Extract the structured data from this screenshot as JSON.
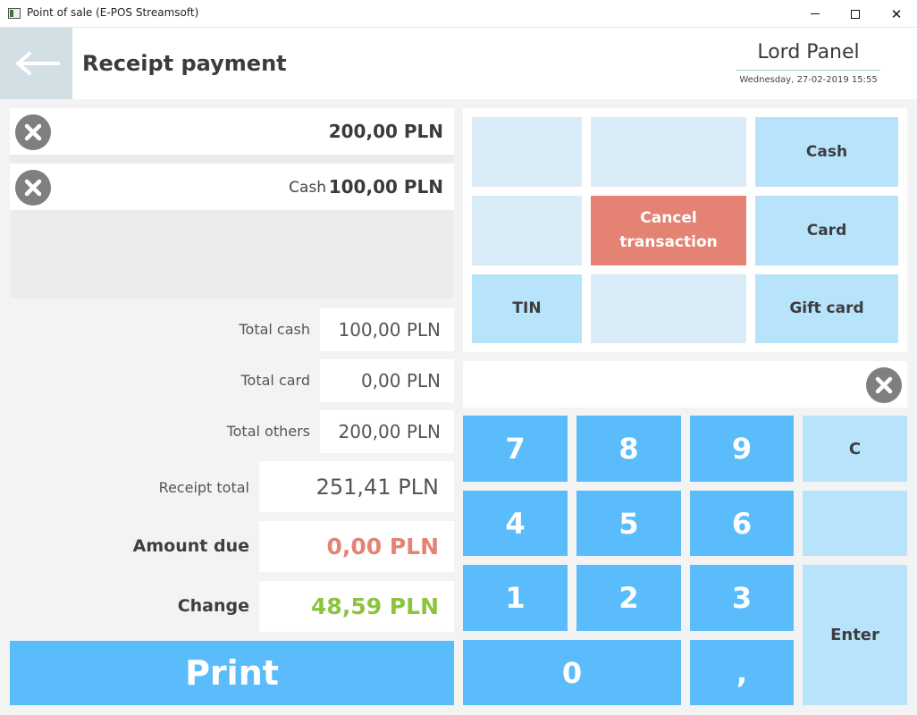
{
  "window": {
    "title": "Point of sale (E-POS Streamsoft)",
    "minimize": "–",
    "maximize": "☐",
    "close": "✕"
  },
  "header": {
    "back_icon": "arrow-left-icon",
    "title": "Receipt payment",
    "user": "Lord Panel",
    "datetime": "Wednesday, 27-02-2019 15:55"
  },
  "payments": [
    {
      "method": "",
      "amount": "200,00 PLN",
      "remove_icon": "remove-circle-icon"
    },
    {
      "method": "Cash",
      "amount": "100,00 PLN",
      "remove_icon": "remove-circle-icon"
    }
  ],
  "totals": {
    "cash_label": "Total cash",
    "cash_value": "100,00 PLN",
    "card_label": "Total card",
    "card_value": "0,00 PLN",
    "others_label": "Total others",
    "others_value": "200,00 PLN",
    "receipt_label": "Receipt total",
    "receipt_value": "251,41 PLN",
    "due_label": "Amount due",
    "due_value": "0,00 PLN",
    "change_label": "Change",
    "change_value": "48,59 PLN"
  },
  "colors": {
    "due": "#e48373",
    "change": "#8cc43f",
    "accent": "#5bbcfb",
    "light_accent": "#b7e3fb",
    "cancel": "#e48373"
  },
  "print_label": "Print",
  "functions": {
    "cash": "Cash",
    "cancel_line1": "Cancel",
    "cancel_line2": "transaction",
    "card": "Card",
    "tin": "TIN",
    "gift_card": "Gift card"
  },
  "input": {
    "value": "",
    "clear_icon": "clear-circle-icon"
  },
  "keypad": {
    "k7": "7",
    "k8": "8",
    "k9": "9",
    "k4": "4",
    "k5": "5",
    "k6": "6",
    "k1": "1",
    "k2": "2",
    "k3": "3",
    "k0": "0",
    "comma": ",",
    "clear": "C",
    "enter": "Enter"
  }
}
